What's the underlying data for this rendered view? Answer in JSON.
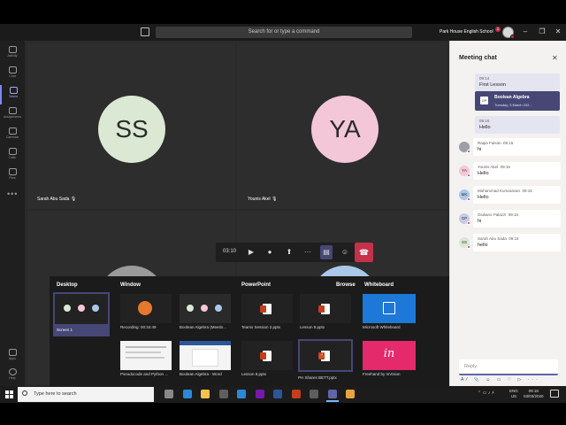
{
  "titlebar": {
    "search_placeholder": "Search for or type a command",
    "org_name": "Park House English School",
    "org_badge": "1",
    "window_controls": {
      "minimize": "–",
      "maximize": "❐",
      "close": "✕"
    }
  },
  "rail": {
    "items": [
      {
        "label": "Activity",
        "icon": "bell-icon"
      },
      {
        "label": "Chat",
        "icon": "chat-icon"
      },
      {
        "label": "Teams",
        "icon": "teams-icon"
      },
      {
        "label": "Assignments",
        "icon": "assignments-icon"
      },
      {
        "label": "Calendar",
        "icon": "calendar-icon"
      },
      {
        "label": "Calls",
        "icon": "phone-icon"
      },
      {
        "label": "Files",
        "icon": "files-icon"
      }
    ],
    "more": "•••",
    "bottom_items": [
      {
        "label": "Apps",
        "icon": "apps-icon"
      },
      {
        "label": "Help",
        "icon": "help-icon"
      }
    ]
  },
  "participants": [
    {
      "initials": "SS",
      "name": "Sarah Abu Sada",
      "bg": "#dbe8d4"
    },
    {
      "initials": "YA",
      "name": "Younis Akel",
      "bg": "#f4c7d8"
    }
  ],
  "controls": {
    "timer": "03:10",
    "video_icon": "video-icon",
    "mic_icon": "mic-icon",
    "share_icon": "share-tray-icon",
    "more_icon": "more-icon",
    "chat_icon": "chat-icon",
    "people_icon": "people-icon",
    "hangup_icon": "hang-up-icon"
  },
  "share_tray": {
    "sections": {
      "desktop": "Desktop",
      "window": "Window",
      "powerpoint": "PowerPoint",
      "browse": "Browse",
      "whiteboard": "Whiteboard"
    },
    "desktop_items": [
      {
        "label": "Screen 1"
      }
    ],
    "window_items": [
      {
        "label": "Recording: 00:34:49"
      },
      {
        "label": "Boolean Algebra (Meetin..."
      },
      {
        "label": "Pseudocode and Python ..."
      },
      {
        "label": "Boolean Algebra - Word"
      }
    ],
    "ppt_items": [
      {
        "label": "Teams Session 2.pptx"
      },
      {
        "label": "Lesson 9.pptx"
      },
      {
        "label": "Lesson 8.pptx"
      },
      {
        "label": "PH Shares BETT.pptx"
      }
    ],
    "whiteboard_items": [
      {
        "label": "Microsoft Whiteboard",
        "color": "#1e78d7"
      },
      {
        "label": "Freehand by InVision",
        "color": "#e42a6a",
        "mark": "in"
      }
    ]
  },
  "chat": {
    "title": "Meeting chat",
    "close": "✕",
    "my_messages": [
      {
        "time": "09:14",
        "text": "First Lesson"
      },
      {
        "time": "09:15",
        "text": "Hello"
      }
    ],
    "card": {
      "title": "Boolean Algebra",
      "subtitle": "Tuesday, 3 March 202...",
      "badge": "GP"
    },
    "messages": [
      {
        "initials": "",
        "name": "Raqia Faisan",
        "time": "09:15",
        "text": "hi",
        "color": "#9aa0a6"
      },
      {
        "initials": "YA",
        "name": "Younis Akel",
        "time": "09:15",
        "text": "Hello",
        "color": "#f4c7d8"
      },
      {
        "initials": "MK",
        "name": "Muhammad Kumaravan",
        "time": "09:15",
        "text": "Hello",
        "color": "#a9c8ea"
      },
      {
        "initials": "GP",
        "name": "Giuliano Palazzi",
        "time": "09:15",
        "text": "hi",
        "color": "#c7cbe8"
      },
      {
        "initials": "SS",
        "name": "Sarah Abu Sada",
        "time": "09:16",
        "text": "hello",
        "color": "#dbe8d4"
      }
    ],
    "reply_placeholder": "Reply",
    "tools": "A⁄ 📎 ☺ ▭ ♡ ▷ ···"
  },
  "taskbar": {
    "search_placeholder": "Type here to search",
    "lang": {
      "code": "ENG",
      "region": "US"
    },
    "clock": {
      "time": "09:18",
      "date": "03/03/2020"
    },
    "apps": [
      {
        "icon": "task-view-icon",
        "color": "#888"
      },
      {
        "icon": "edge-icon",
        "color": "#2b88d8"
      },
      {
        "icon": "explorer-icon",
        "color": "#f2c14e"
      },
      {
        "icon": "store-icon",
        "color": "#5e5e5e"
      },
      {
        "icon": "mail-icon",
        "color": "#2b88d8"
      },
      {
        "icon": "onenote-icon",
        "color": "#7719aa"
      },
      {
        "icon": "word-icon",
        "color": "#2b579a"
      },
      {
        "icon": "powerpoint-icon",
        "color": "#c43e1c"
      },
      {
        "icon": "gear-icon",
        "color": "#5e5e5e"
      },
      {
        "icon": "teams-icon",
        "color": "#6264a7"
      },
      {
        "icon": "app-icon",
        "color": "#e8a33d"
      }
    ]
  }
}
